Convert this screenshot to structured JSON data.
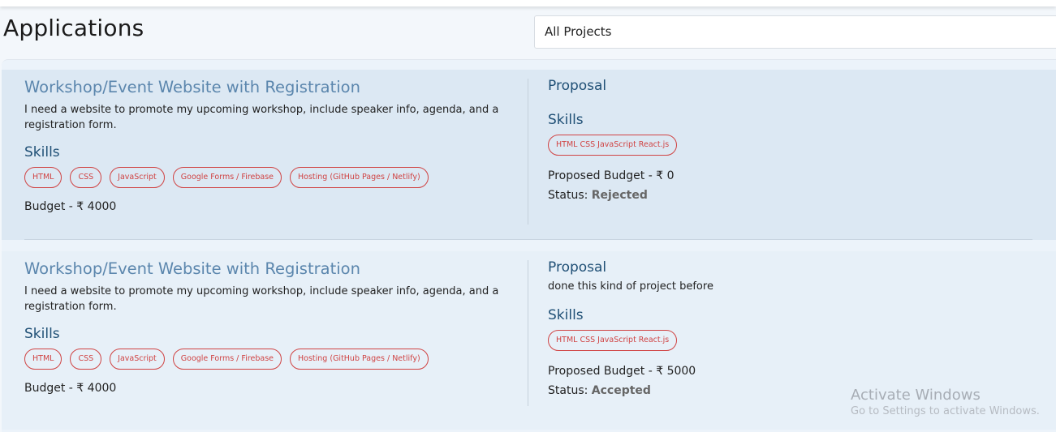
{
  "page": {
    "title": "Applications",
    "project_filter": "All Projects"
  },
  "applications": [
    {
      "title": "Workshop/Event Website with Registration",
      "description": "I need a website to promote my upcoming workshop, include speaker info, agenda, and a registration form.",
      "skills_heading": "Skills",
      "skills": [
        "HTML",
        "CSS",
        "JavaScript",
        "Google Forms / Firebase",
        "Hosting (GitHub Pages / Netlify)"
      ],
      "budget": "Budget - ₹ 4000",
      "proposal_heading": "Proposal",
      "proposal_text": "",
      "proposal_skills_heading": "Skills",
      "proposal_skills": "HTML CSS JavaScript React.js",
      "proposed_budget": "Proposed Budget - ₹ 0",
      "status_label": "Status:",
      "status_value": "Rejected"
    },
    {
      "title": "Workshop/Event Website with Registration",
      "description": "I need a website to promote my upcoming workshop, include speaker info, agenda, and a registration form.",
      "skills_heading": "Skills",
      "skills": [
        "HTML",
        "CSS",
        "JavaScript",
        "Google Forms / Firebase",
        "Hosting (GitHub Pages / Netlify)"
      ],
      "budget": "Budget - ₹ 4000",
      "proposal_heading": "Proposal",
      "proposal_text": "done this kind of project before",
      "proposal_skills_heading": "Skills",
      "proposal_skills": "HTML CSS JavaScript React.js",
      "proposed_budget": "Proposed Budget - ₹ 5000",
      "status_label": "Status:",
      "status_value": "Accepted"
    }
  ],
  "watermark": {
    "title": "Activate Windows",
    "subtitle": "Go to Settings to activate Windows."
  }
}
